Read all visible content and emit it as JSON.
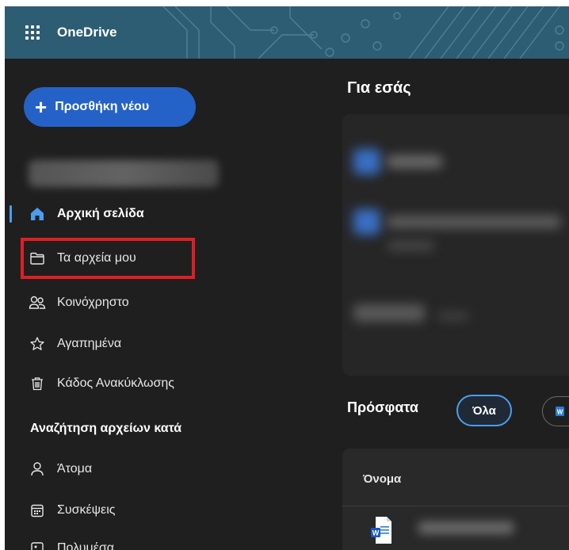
{
  "app": {
    "name": "OneDrive",
    "brand_color": "#2d5d73"
  },
  "topbar": {
    "launcher_icon": "app-launcher-waffle-icon"
  },
  "sidebar": {
    "add_new_label": "Προσθήκη νέου",
    "account_name": "",
    "items": [
      {
        "label": "Αρχική σελίδα",
        "icon": "home-icon",
        "active": true
      },
      {
        "label": "Τα αρχεία μου",
        "icon": "folder-icon",
        "highlighted": true
      },
      {
        "label": "Κοινόχρηστο",
        "icon": "people-icon"
      },
      {
        "label": "Αγαπημένα",
        "icon": "star-icon"
      },
      {
        "label": "Κάδος Ανακύκλωσης",
        "icon": "trash-icon"
      }
    ],
    "browse_section_title": "Αναζήτηση αρχείων κατά",
    "browse_items": [
      {
        "label": "Άτομα",
        "icon": "person-icon"
      },
      {
        "label": "Συσκέψεις",
        "icon": "calendar-icon"
      },
      {
        "label": "Πολυμέσα",
        "icon": "media-icon"
      }
    ]
  },
  "main": {
    "for_you_title": "Για εσάς",
    "recent_title": "Πρόσφατα",
    "filter_all_label": "Όλα",
    "filter_word_icon": "word-icon",
    "list_header_name": "Όνομα",
    "accent_color": "#4c9cf0",
    "highlight_color": "#e01e25"
  }
}
